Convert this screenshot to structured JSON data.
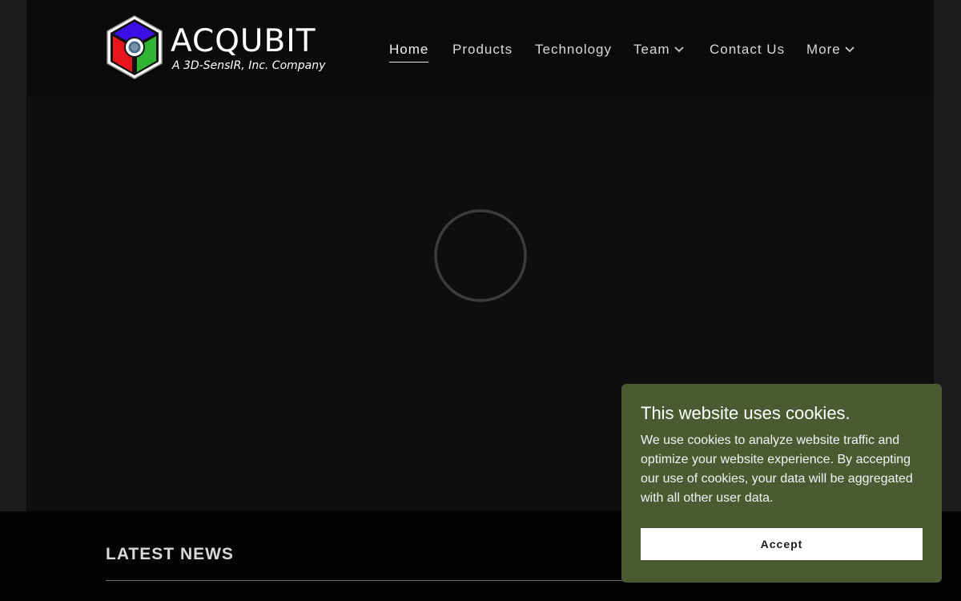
{
  "brand": {
    "name": "ACQUBIT",
    "tagline": "A 3D-SensIR, Inc. Company",
    "logo_icon": "cube-logo-icon",
    "colors": {
      "blue": "#3b10e8",
      "red": "#e8161c",
      "green": "#2fb533",
      "outline": "#ffffff"
    }
  },
  "nav": {
    "items": [
      {
        "label": "Home",
        "active": true
      },
      {
        "label": "Products"
      },
      {
        "label": "Technology"
      },
      {
        "label": "Team",
        "dropdown": true
      },
      {
        "label": "Contact Us"
      },
      {
        "label": "More",
        "dropdown": true
      }
    ]
  },
  "hero": {
    "loading_icon": "loading-spinner-icon"
  },
  "news": {
    "title": "LATEST NEWS"
  },
  "cookie_banner": {
    "title": "This website uses cookies.",
    "body": "We use cookies to analyze website traffic and optimize your website experience. By accepting our use of cookies, your data will be aggregated with all other user data.",
    "accept_label": "Accept",
    "background": "#4b5a31"
  }
}
